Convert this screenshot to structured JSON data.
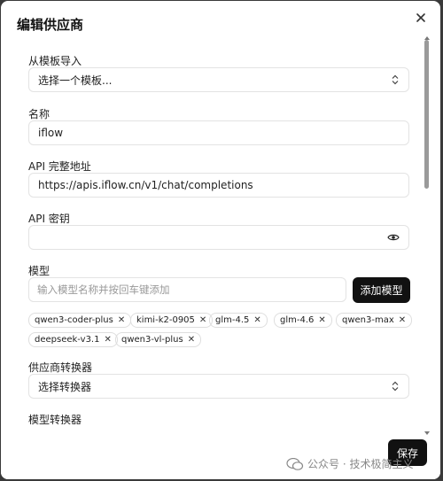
{
  "dialog": {
    "title": "编辑供应商",
    "close_icon": "close-icon"
  },
  "template": {
    "label": "从模板导入",
    "value": "选择一个模板..."
  },
  "name": {
    "label": "名称",
    "value": "iflow"
  },
  "api_url": {
    "label": "API 完整地址",
    "value": "https://apis.iflow.cn/v1/chat/completions"
  },
  "api_key": {
    "label": "API 密钥",
    "value": ""
  },
  "models": {
    "label": "模型",
    "placeholder": "输入模型名称并按回车键添加",
    "add_label": "添加模型",
    "chips": [
      "qwen3-coder-plus",
      "kimi-k2-0905",
      "glm-4.5",
      "glm-4.6",
      "qwen3-max",
      "deepseek-v3.1",
      "qwen3-vl-plus"
    ]
  },
  "provider_transformer": {
    "label": "供应商转换器",
    "value": "选择转换器"
  },
  "model_transformer": {
    "label": "模型转换器"
  },
  "footer": {
    "save_label": "保存"
  },
  "watermark": {
    "text": "公众号 · 技术极简主义"
  }
}
